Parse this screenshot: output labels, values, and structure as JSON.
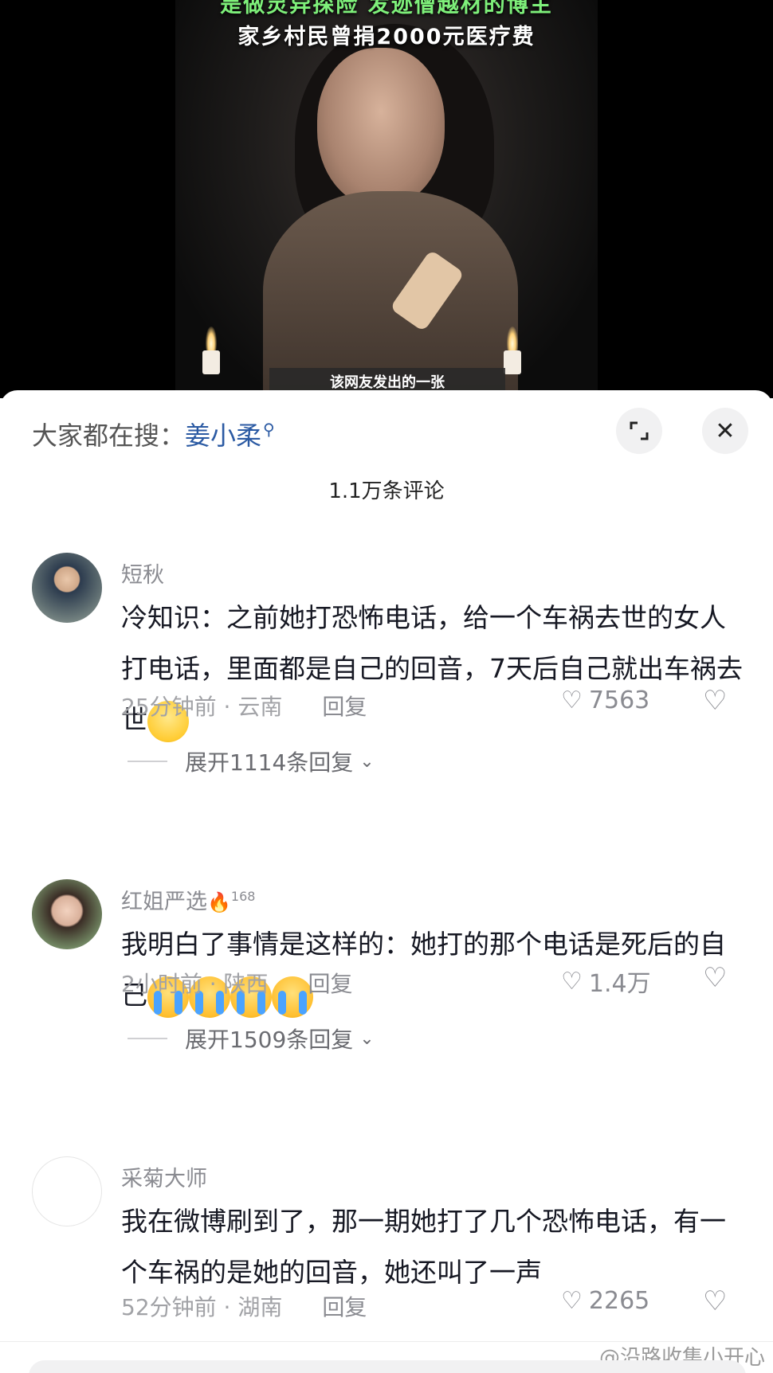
{
  "video": {
    "title_line1": "是做灵异探险 发迹僧越材的博主",
    "title_line2": "家乡村民曾捐2000元医疗费",
    "subtitle": "该网友发出的一张"
  },
  "search_hint": {
    "prefix": "大家都在搜：",
    "keyword": "姜小柔",
    "search_icon": "search-icon"
  },
  "buttons": {
    "expand_icon": "expand-icon",
    "close_icon": "close-icon"
  },
  "comment_count_title": "1.1万条评论",
  "comments": [
    {
      "username": "短秋",
      "text": "冷知识：之前她打恐怖电话，给一个车祸去世的女人打电话，里面都是自己的回音，7天后自己就出车祸去世",
      "emoji": "shocked-emoji",
      "time_location": "25分钟前 · 云南",
      "reply_label": "回复",
      "likes": "7563",
      "expand_label": "展开1114条回复"
    },
    {
      "username": "红姐严选",
      "user_badge": "🔥",
      "user_level": "168",
      "text": "我明白了事情是这样的：她打的那个电话是死后的自己",
      "emoji": "crying-emoji",
      "time_location": "2小时前 · 陕西",
      "reply_label": "回复",
      "likes": "1.4万",
      "expand_label": "展开1509条回复"
    },
    {
      "username": "采菊大师",
      "text": "我在微博刷到了，那一期她打了几个恐怖电话，有一个车祸的是她的回音，她还叫了一声",
      "time_location": "52分钟前 · 湖南",
      "reply_label": "回复",
      "likes": "2265"
    }
  ],
  "watermark": "@沿路收集小开心"
}
